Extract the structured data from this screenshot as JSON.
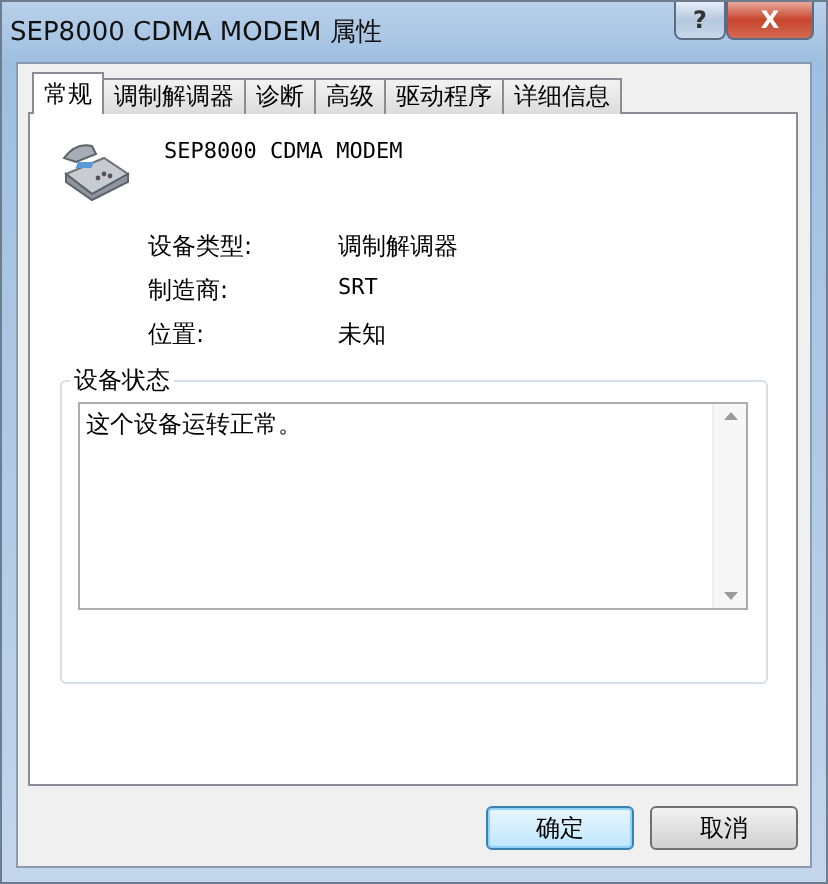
{
  "window": {
    "title": "SEP8000 CDMA MODEM 属性",
    "help": "?",
    "close": "X"
  },
  "tabs": [
    {
      "label": "常规",
      "selected": true
    },
    {
      "label": "调制解调器",
      "selected": false
    },
    {
      "label": "诊断",
      "selected": false
    },
    {
      "label": "高级",
      "selected": false
    },
    {
      "label": "驱动程序",
      "selected": false
    },
    {
      "label": "详细信息",
      "selected": false
    }
  ],
  "device": {
    "name": "SEP8000 CDMA MODEM"
  },
  "properties": [
    {
      "label": "设备类型:",
      "value": "调制解调器"
    },
    {
      "label": "制造商:",
      "value": "SRT"
    },
    {
      "label": "位置:",
      "value": "未知"
    }
  ],
  "status": {
    "title": "设备状态",
    "text": "这个设备运转正常。"
  },
  "buttons": [
    {
      "label": "确定",
      "default": true
    },
    {
      "label": "取消",
      "default": false
    }
  ]
}
